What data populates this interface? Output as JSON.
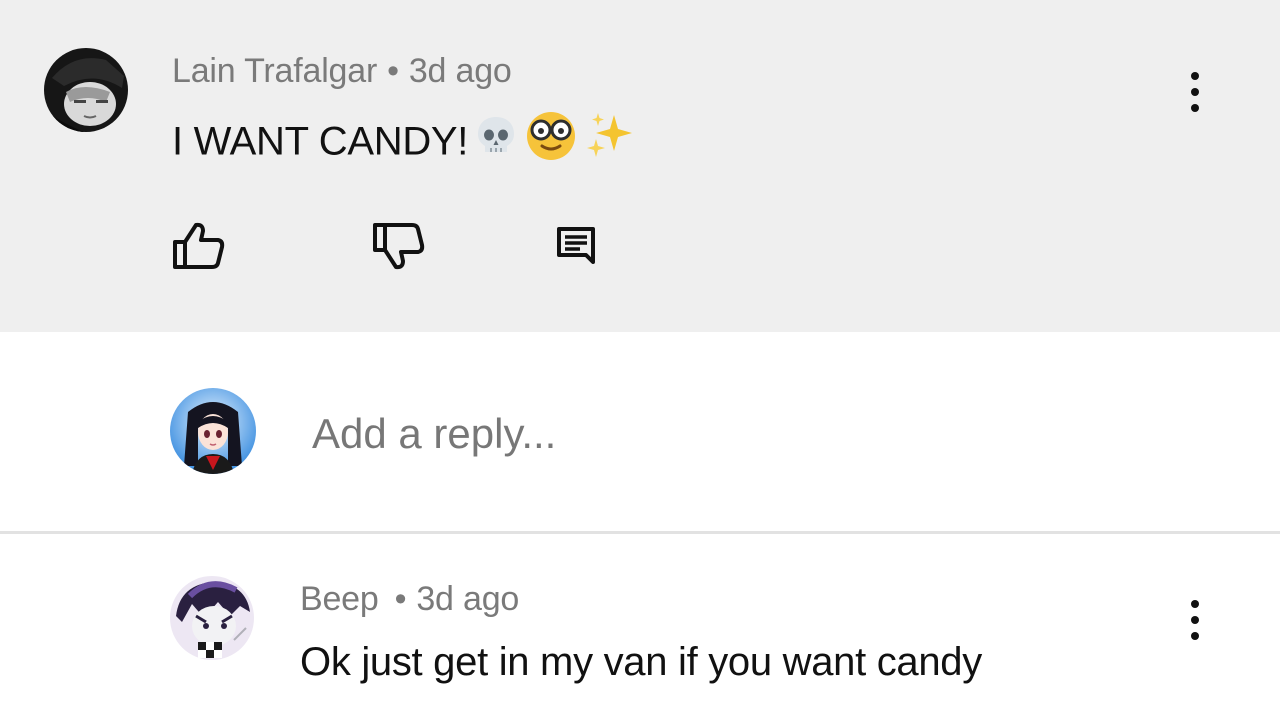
{
  "comment": {
    "author": "Lain Trafalgar",
    "separator": "•",
    "time": "3d ago",
    "text": "I WANT CANDY!",
    "emojis": [
      "skull-emoji",
      "disguised-face-emoji",
      "sparkles-emoji"
    ],
    "actions": [
      "like",
      "dislike",
      "reply"
    ]
  },
  "reply_box": {
    "placeholder": "Add a reply..."
  },
  "reply": {
    "author": "Beep",
    "separator": "•",
    "time": "3d ago",
    "text": "Ok just get in my van if you want candy"
  },
  "colors": {
    "highlight_bg": "#efefef",
    "meta_text": "#7a7a7a",
    "body_text": "#111111",
    "divider": "#e2e2e2"
  }
}
